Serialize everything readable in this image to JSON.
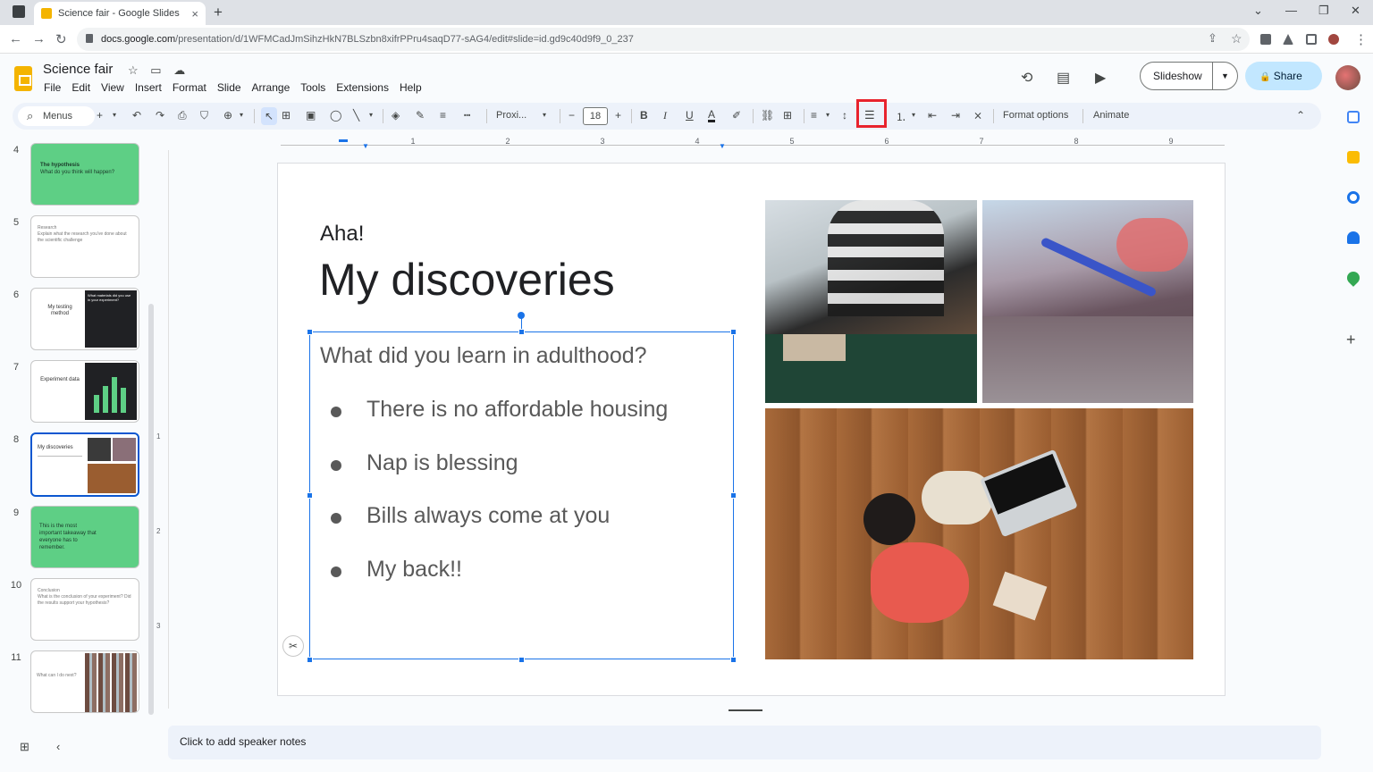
{
  "browser": {
    "tab_title": "Science fair - Google Slides",
    "tab_close": "×",
    "new_tab": "+",
    "url_host": "docs.google.com",
    "url_path": "/presentation/d/1WFMCadJmSihzHkN7BLSzbn8xifrPPru4saqD77-sAG4/edit#slide=id.gd9c40d9f9_0_237",
    "win_minimize": "—",
    "win_restore": "❐",
    "win_close": "✕",
    "tab_list": "⌄",
    "back": "←",
    "forward": "→",
    "reload": "↻",
    "star": "☆",
    "share_page": "⇪",
    "more": "⋮"
  },
  "doc": {
    "title": "Science fair",
    "star_icon": "☆",
    "folder_icon": "▭",
    "cloud_icon": "☁",
    "menu": [
      "File",
      "Edit",
      "View",
      "Insert",
      "Format",
      "Slide",
      "Arrange",
      "Tools",
      "Extensions",
      "Help"
    ],
    "history_icon": "⟲",
    "comment_icon": "▤",
    "meet_icon": "▶",
    "slideshow_label": "Slideshow",
    "slideshow_caret": "▼",
    "share_label": "Share",
    "share_icon": "🔒"
  },
  "toolbar": {
    "menus_label": "Menus",
    "font_name": "Proxi...",
    "font_size": "18",
    "format_options": "Format options",
    "animate": "Animate",
    "new_slide": "+",
    "undo": "↶",
    "redo": "↷",
    "print": "⎙",
    "paint_format": "⛉",
    "zoom": "⊕",
    "select": "↖",
    "textbox": "⊞",
    "image": "▣",
    "shape": "◯",
    "line": "╲",
    "fill": "◈",
    "pen": "✎",
    "border_weight": "≡",
    "border_dash": "┅",
    "decrease_font": "−",
    "increase_font": "+",
    "bold": "B",
    "italic": "I",
    "underline": "U",
    "text_color": "A",
    "highlight": "✐",
    "link": "⛓",
    "comment": "⊞",
    "align": "≡",
    "line_spacing": "↕",
    "bulleted_list": "☰",
    "numbered_list": "⒈",
    "decrease_indent": "⇤",
    "increase_indent": "⇥",
    "clear_format": "⨯",
    "collapse": "⌃",
    "dropdown_caret": "▾"
  },
  "ruler": {
    "ticks": [
      "1",
      "2",
      "3",
      "4",
      "5",
      "6",
      "7",
      "8",
      "9"
    ],
    "vticks": [
      "1",
      "2",
      "3"
    ]
  },
  "filmstrip": [
    {
      "num": "4",
      "title": "The hypothesis",
      "body": "What do you think will happen?",
      "style": "green"
    },
    {
      "num": "5",
      "title": "Research",
      "body": "Explain what the research you've done about the scientific challenge",
      "style": "white"
    },
    {
      "num": "6",
      "title": "My testing method",
      "body": "What materials did you use in your experiment?",
      "style": "split-dark"
    },
    {
      "num": "7",
      "title": "Experiment data",
      "body": "",
      "style": "chart-dark"
    },
    {
      "num": "8",
      "title": "My discoveries",
      "body": "",
      "style": "selected"
    },
    {
      "num": "9",
      "title": "This is the most important takeaway that everyone has to remember.",
      "body": "",
      "style": "green"
    },
    {
      "num": "10",
      "title": "Conclusion",
      "body": "What is the conclusion of your experiment? Did the results support your hypothesis?",
      "style": "white"
    },
    {
      "num": "11",
      "title": "What can I do next?",
      "body": "",
      "style": "books"
    }
  ],
  "slide": {
    "kicker": "Aha!",
    "title": "My discoveries",
    "question": "What did you learn in adulthood?",
    "bullets": [
      "There is no affordable housing",
      "Nap is blessing",
      "Bills always come at you",
      "My back!!"
    ],
    "crop_icon": "✂"
  },
  "notes": {
    "placeholder": "Click to add speaker notes"
  },
  "bottom": {
    "grid_icon": "⊞",
    "collapse_icon": "‹",
    "expand_icon": "›"
  },
  "side": {
    "add_icon": "+"
  }
}
